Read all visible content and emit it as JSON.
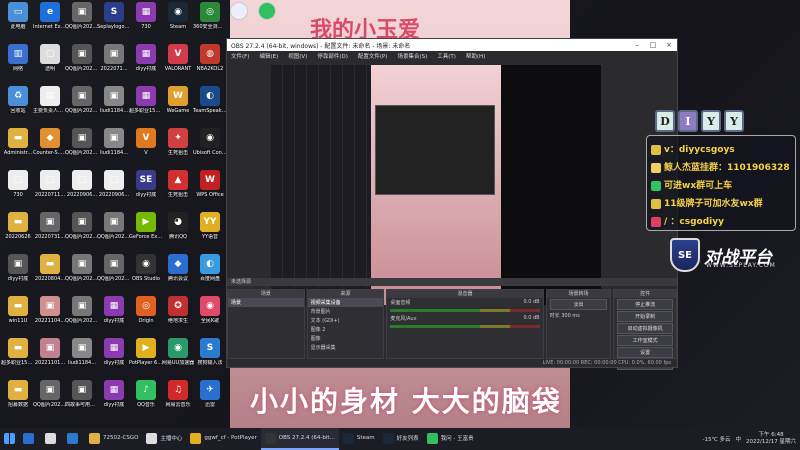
{
  "desktop": {
    "icons": [
      {
        "label": "此电脑",
        "color": "#4a90d9",
        "glyph": "▭"
      },
      {
        "label": "Internet Explorer",
        "color": "#1e6fd9",
        "glyph": "e"
      },
      {
        "label": "QQ图片2022071...",
        "color": "#666",
        "glyph": "▣"
      },
      {
        "label": "Seplaylogo_修...",
        "color": "#2a3c8a",
        "glyph": "S"
      },
      {
        "label": "730",
        "color": "#8c3ab0",
        "glyph": "▦"
      },
      {
        "label": "Steam",
        "color": "#1b2838",
        "glyph": "◉"
      },
      {
        "label": "360安全浏览器",
        "color": "#2a8a3a",
        "glyph": "◎"
      },
      {
        "label": "网络",
        "color": "#3a6fd0",
        "glyph": "▥"
      },
      {
        "label": "透明",
        "color": "#ddd",
        "glyph": "▢"
      },
      {
        "label": "QQ图片2022071...",
        "color": "#555",
        "glyph": "▣"
      },
      {
        "label": "2022071...",
        "color": "#777",
        "glyph": "▣"
      },
      {
        "label": "diyy衬底",
        "color": "#8c3ab0",
        "glyph": "▦"
      },
      {
        "label": "VALORANT",
        "color": "#d33a4a",
        "glyph": "V"
      },
      {
        "label": "NBA2KOL2",
        "color": "#c0392b",
        "glyph": "◍"
      },
      {
        "label": "回收站",
        "color": "#4a90d9",
        "glyph": "♻"
      },
      {
        "label": "主要负责人微信二维码",
        "color": "#eee",
        "glyph": "▤"
      },
      {
        "label": "QQ图片2022070...",
        "color": "#666",
        "glyph": "▣"
      },
      {
        "label": "liudi1184...",
        "color": "#888",
        "glyph": "▣"
      },
      {
        "label": "超多职业154集录...",
        "color": "#8c3ab0",
        "glyph": "▦"
      },
      {
        "label": "WeGame",
        "color": "#e0a030",
        "glyph": "W"
      },
      {
        "label": "TeamSpeak 3 Client",
        "color": "#1a4a8a",
        "glyph": "◐"
      },
      {
        "label": "Administr...",
        "color": "#e0b040",
        "glyph": "▬"
      },
      {
        "label": "Counter-S... Global Off...",
        "color": "#e09030",
        "glyph": "◆"
      },
      {
        "label": "QQ图片2022070...",
        "color": "#555",
        "glyph": "▣"
      },
      {
        "label": "liudi1184...",
        "color": "#888",
        "glyph": "▣"
      },
      {
        "label": "V",
        "color": "#e07820",
        "glyph": "V"
      },
      {
        "label": "生死狙击",
        "color": "#d04040",
        "glyph": "✦"
      },
      {
        "label": "Ubisoft Connect",
        "color": "#222",
        "glyph": "◉"
      },
      {
        "label": "730",
        "color": "#eee",
        "glyph": "▢"
      },
      {
        "label": "20220711...",
        "color": "#eee",
        "glyph": "▢"
      },
      {
        "label": "20220906...",
        "color": "#eee",
        "glyph": "▢"
      },
      {
        "label": "20220906...",
        "color": "#eee",
        "glyph": "▢"
      },
      {
        "label": "diyy衬底",
        "color": "#3a3a8a",
        "glyph": "SE"
      },
      {
        "label": "生死狙击",
        "color": "#d03030",
        "glyph": "▲"
      },
      {
        "label": "WPS Office",
        "color": "#c02020",
        "glyph": "W"
      },
      {
        "label": "20220626",
        "color": "#e0b040",
        "glyph": "▬"
      },
      {
        "label": "20220731...",
        "color": "#666",
        "glyph": "▣"
      },
      {
        "label": "QQ图片2022070...",
        "color": "#555",
        "glyph": "▣"
      },
      {
        "label": "QQ图片2022071...",
        "color": "#777",
        "glyph": "▣"
      },
      {
        "label": "GeForce Experience",
        "color": "#76b900",
        "glyph": "▶"
      },
      {
        "label": "腾讯QQ",
        "color": "#222",
        "glyph": "◕"
      },
      {
        "label": "YY语音",
        "color": "#e0b020",
        "glyph": "YY"
      },
      {
        "label": "diyy衬底",
        "color": "#555",
        "glyph": "▣"
      },
      {
        "label": "20220804...",
        "color": "#e0b040",
        "glyph": "▬"
      },
      {
        "label": "QQ图片2022071...",
        "color": "#777",
        "glyph": "▣"
      },
      {
        "label": "QQ图片2022071...",
        "color": "#666",
        "glyph": "▣"
      },
      {
        "label": "OBS Studio",
        "color": "#333",
        "glyph": "◉"
      },
      {
        "label": "腾讯会议",
        "color": "#2a6fd0",
        "glyph": "◆"
      },
      {
        "label": "百度网盘",
        "color": "#3a9ae0",
        "glyph": "◐"
      },
      {
        "label": "win11U",
        "color": "#e0b040",
        "glyph": "▬"
      },
      {
        "label": "20221104...",
        "color": "#d09090",
        "glyph": "▣"
      },
      {
        "label": "QQ图片2022071...",
        "color": "#777",
        "glyph": "▣"
      },
      {
        "label": "diyy衬底",
        "color": "#8c3ab0",
        "glyph": "▦"
      },
      {
        "label": "Origin",
        "color": "#e06020",
        "glyph": "◎"
      },
      {
        "label": "绝地求生",
        "color": "#c03030",
        "glyph": "✪"
      },
      {
        "label": "全民K歌",
        "color": "#e04a6a",
        "glyph": "◉"
      },
      {
        "label": "超多职业154集录...",
        "color": "#e0b040",
        "glyph": "▬"
      },
      {
        "label": "20221101...",
        "color": "#c08090",
        "glyph": "▣"
      },
      {
        "label": "liudi1184...",
        "color": "#888",
        "glyph": "▣"
      },
      {
        "label": "diyy衬底",
        "color": "#8c3ab0",
        "glyph": "▦"
      },
      {
        "label": "PotPlayer 64 bit",
        "color": "#e0b020",
        "glyph": "▶"
      },
      {
        "label": "网易UU加速器",
        "color": "#2a9a6a",
        "glyph": "◉"
      },
      {
        "label": "搜狗输入法",
        "color": "#2a7ad0",
        "glyph": "S"
      },
      {
        "label": "招募数据",
        "color": "#e0b040",
        "glyph": "▬"
      },
      {
        "label": "QQ图片2022071...",
        "color": "#666",
        "glyph": "▣"
      },
      {
        "label": "四故事可用图端",
        "color": "#555",
        "glyph": "▣"
      },
      {
        "label": "diyy衬底",
        "color": "#8c3ab0",
        "glyph": "▦"
      },
      {
        "label": "QQ音乐",
        "color": "#30c060",
        "glyph": "♪"
      },
      {
        "label": "网易云音乐",
        "color": "#d02a2a",
        "glyph": "♫"
      },
      {
        "label": "迅雷",
        "color": "#2a6fd0",
        "glyph": "✈"
      }
    ]
  },
  "obs": {
    "title": "OBS 27.2.4 (64-bit, windows) - 配置文件: 未命名 - 场景: 未命名",
    "menu": [
      "文件(F)",
      "编辑(E)",
      "视图(V)",
      "停靠部件(D)",
      "配置文件(P)",
      "场景集合(S)",
      "工具(T)",
      "帮助(H)"
    ],
    "source_bar": "未选择源",
    "docks": {
      "scenes_title": "场景",
      "scenes": [
        "场景"
      ],
      "sources_title": "来源",
      "sources": [
        "视频采集设备",
        "背景图片",
        "文本 (GDI+)",
        "图像 2",
        "图像",
        "显示器采集"
      ],
      "mixer_title": "混音器",
      "mixer": [
        {
          "name": "桌面音频",
          "db": "0.0 dB"
        },
        {
          "name": "麦克风/Aux",
          "db": "0.0 dB"
        }
      ],
      "transitions_title": "场景转场",
      "transition_name": "淡出",
      "duration_label": "时长",
      "duration_value": "300 ms",
      "controls_title": "控件",
      "controls": [
        "停止推流",
        "开始录制",
        "启动虚拟摄像机",
        "工作室模式",
        "设置",
        "退出"
      ]
    },
    "status": "LIVE: 00:00:00   REC: 00:00:00   CPU: 0.0%, 60.00 fps"
  },
  "overlay": {
    "letters": [
      "D",
      "I",
      "Y",
      "Y"
    ],
    "lines": [
      {
        "text": "v：diyycsgoys",
        "icon_color": "#e0c040"
      },
      {
        "text": "鲸人杰蓝挂群：1101906328",
        "icon_color": "#f0d060"
      },
      {
        "text": "可进wx群可上车",
        "icon_color": "#30c060"
      },
      {
        "text": "11级牌子可加水友wx群",
        "icon_color": "#e0c040"
      },
      {
        "text": "/ ：csgodiyy",
        "icon_color": "#e04060"
      }
    ],
    "brand": "对战平台",
    "brand_short": "SE",
    "brand_url": "WWW.SEPLAY.COM"
  },
  "video": {
    "top_text": "我的小玉爱",
    "bottom_text": "小小的身材 大大的脑袋"
  },
  "taskbar": {
    "items": [
      {
        "label": "",
        "color": "#2a6fd0"
      },
      {
        "label": "",
        "color": "#ddd"
      },
      {
        "label": "",
        "color": "#2a7ad0"
      },
      {
        "label": "72502-CSGO",
        "color": "#e0b040"
      },
      {
        "label": "主播中心",
        "color": "#ddd"
      },
      {
        "label": "ggwf_cf - PotPlayer",
        "color": "#e0b020"
      },
      {
        "label": "OBS 27.2.4 (64-bit...",
        "color": "#333"
      },
      {
        "label": "Steam",
        "color": "#1b2838"
      },
      {
        "label": "好友列表",
        "color": "#1b2838"
      },
      {
        "label": "我问 - 王富贵",
        "color": "#30c060"
      }
    ],
    "tray": {
      "temp": "-15℃ 多云",
      "lang": "中",
      "time": "下午 6:48",
      "date": "2022/12/17 星期六"
    }
  }
}
